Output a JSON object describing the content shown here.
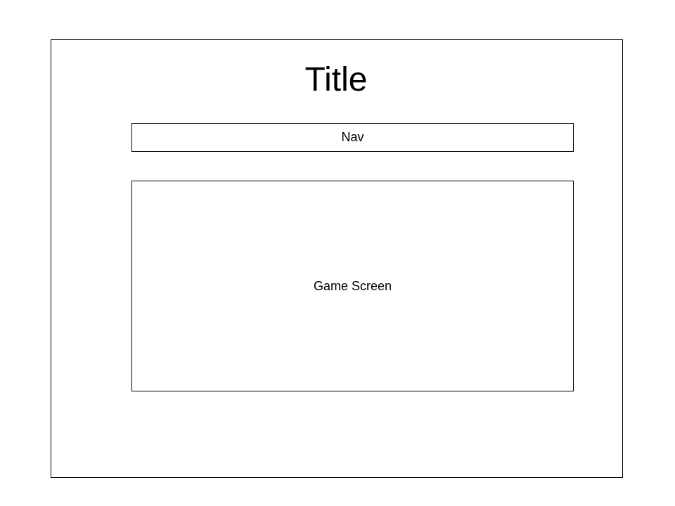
{
  "title": "Title",
  "nav": {
    "label": "Nav"
  },
  "game_screen": {
    "label": "Game Screen"
  }
}
